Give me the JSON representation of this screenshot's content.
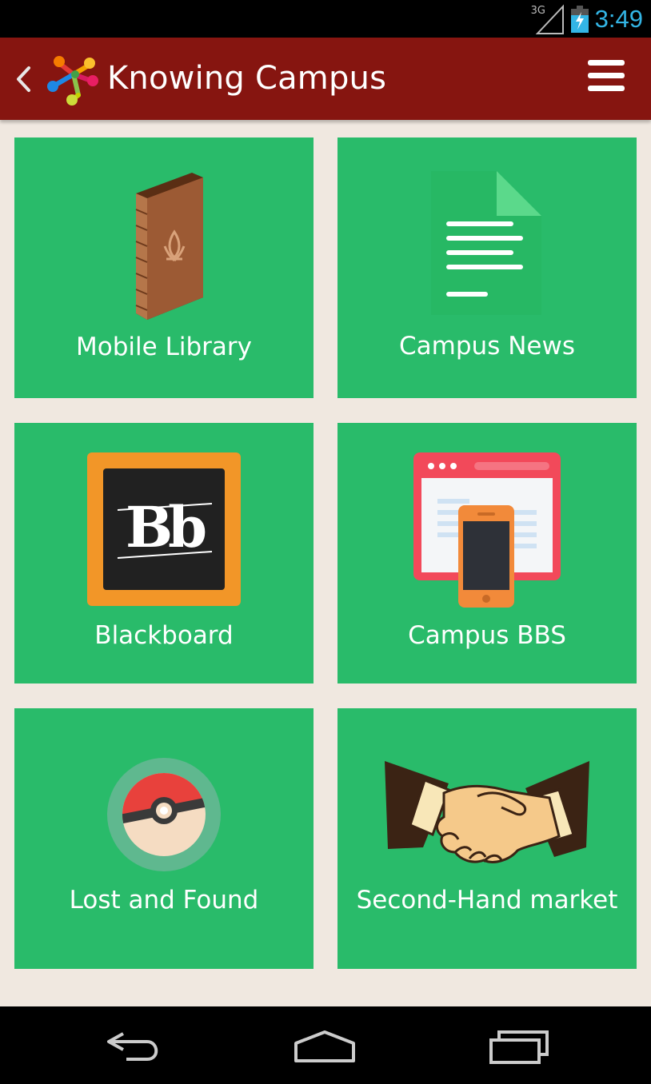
{
  "status_bar": {
    "network": "3G",
    "time": "3:49",
    "time_color": "#33b5e5"
  },
  "app_bar": {
    "title": "Knowing Campus",
    "background": "#861510",
    "back_icon": "chevron-left-icon",
    "logo_icon": "molecule-logo-icon",
    "menu_icon": "hamburger-menu-icon"
  },
  "tiles": [
    {
      "label": "Mobile Library",
      "icon": "book-icon"
    },
    {
      "label": "Campus News",
      "icon": "document-icon"
    },
    {
      "label": "Blackboard",
      "icon": "blackboard-logo-icon",
      "logo_text": "Bb"
    },
    {
      "label": "Campus BBS",
      "icon": "browser-phone-icon"
    },
    {
      "label": "Lost and Found",
      "icon": "pokeball-icon"
    },
    {
      "label": "Second-Hand market",
      "icon": "handshake-icon"
    }
  ],
  "tile_color": "#29bb6a",
  "nav_bar": {
    "back": "back-arrow-icon",
    "home": "home-icon",
    "recents": "recent-apps-icon"
  }
}
